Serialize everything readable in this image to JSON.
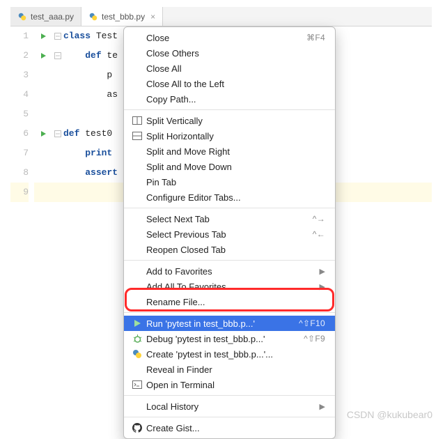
{
  "tabs": [
    {
      "label": "test_aaa.py",
      "active": false
    },
    {
      "label": "test_bbb.py",
      "active": true
    }
  ],
  "code": {
    "lines": [
      {
        "n": "1",
        "run": true,
        "fold": "-",
        "text_a": "class",
        "text_b": " Test"
      },
      {
        "n": "2",
        "run": true,
        "fold": "-",
        "text_a": "    def",
        "text_b": " te"
      },
      {
        "n": "3",
        "run": false,
        "fold": "",
        "text_a": "        p",
        "text_b": ""
      },
      {
        "n": "4",
        "run": false,
        "fold": "",
        "text_a": "        as",
        "text_b": ""
      },
      {
        "n": "5",
        "run": false,
        "fold": "",
        "text_a": "",
        "text_b": ""
      },
      {
        "n": "6",
        "run": true,
        "fold": "-",
        "text_a": "def",
        "text_b": " test0"
      },
      {
        "n": "7",
        "run": false,
        "fold": "",
        "text_a": "    print",
        "text_b": ""
      },
      {
        "n": "8",
        "run": false,
        "fold": "",
        "text_a": "    assert",
        "text_b": ""
      },
      {
        "n": "9",
        "run": false,
        "fold": "",
        "text_a": "",
        "text_b": "",
        "hl": true
      }
    ]
  },
  "menu": {
    "groups": [
      [
        {
          "label": "Close",
          "shortcut": "⌘F4"
        },
        {
          "label": "Close Others"
        },
        {
          "label": "Close All"
        },
        {
          "label": "Close All to the Left"
        },
        {
          "label": "Copy Path..."
        }
      ],
      [
        {
          "icon": "split-v",
          "label": "Split Vertically"
        },
        {
          "icon": "split-h",
          "label": "Split Horizontally"
        },
        {
          "label": "Split and Move Right"
        },
        {
          "label": "Split and Move Down"
        },
        {
          "label": "Pin Tab"
        },
        {
          "label": "Configure Editor Tabs..."
        }
      ],
      [
        {
          "label": "Select Next Tab",
          "shortcut": "^→"
        },
        {
          "label": "Select Previous Tab",
          "shortcut": "^←"
        },
        {
          "label": "Reopen Closed Tab"
        }
      ],
      [
        {
          "label": "Add to Favorites",
          "sub": "▶"
        },
        {
          "label": "Add All To Favorites",
          "sub": "▶"
        },
        {
          "label": "Rename File..."
        }
      ],
      [
        {
          "icon": "run",
          "label": "Run 'pytest in test_bbb.p...'",
          "shortcut": "^⇧F10",
          "selected": true
        },
        {
          "icon": "debug",
          "label": "Debug 'pytest in test_bbb.p...'",
          "shortcut": "^⇧F9"
        },
        {
          "icon": "py",
          "label": "Create 'pytest in test_bbb.p...'..."
        },
        {
          "label": "Reveal in Finder"
        },
        {
          "icon": "terminal",
          "label": "Open in Terminal"
        }
      ],
      [
        {
          "label": "Local History",
          "sub": "▶"
        }
      ],
      [
        {
          "icon": "github",
          "label": "Create Gist..."
        }
      ]
    ]
  },
  "watermark": "CSDN @kukubear0"
}
